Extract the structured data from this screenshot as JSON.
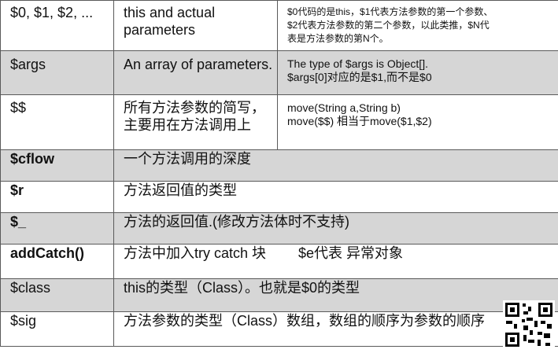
{
  "rows": [
    {
      "key": "$0, $1, $2, ...",
      "desc": "this and actual parameters",
      "note": [
        "$0代码的是this，$1代表方法参数的第一个参数、",
        "$2代表方法参数的第二个参数，以此类推，$N代",
        "表是方法参数的第N个。"
      ]
    },
    {
      "key": "$args",
      "desc": "An array of parameters.",
      "note": [
        "The type of $args is Object[].",
        "$args[0]对应的是$1,而不是$0"
      ]
    },
    {
      "key": "$$",
      "desc": "所有方法参数的简写，主要用在方法调用上",
      "note": [
        "move(String a,String b)",
        "move($$) 相当于move($1,$2)"
      ]
    },
    {
      "key": "$cflow",
      "desc": "一个方法调用的深度"
    },
    {
      "key": "$r",
      "desc": "方法返回值的类型"
    },
    {
      "key": "$_",
      "desc": "方法的返回值.(修改方法体时不支持)"
    },
    {
      "key": "addCatch()",
      "desc": "方法中加入try catch 块　　 $e代表 异常对象"
    },
    {
      "key": "$class",
      "desc": "this的类型（Class）。也就是$0的类型"
    },
    {
      "key": "$sig",
      "desc": "方法参数的类型（Class）数组，数组的顺序为参数的顺序"
    }
  ]
}
